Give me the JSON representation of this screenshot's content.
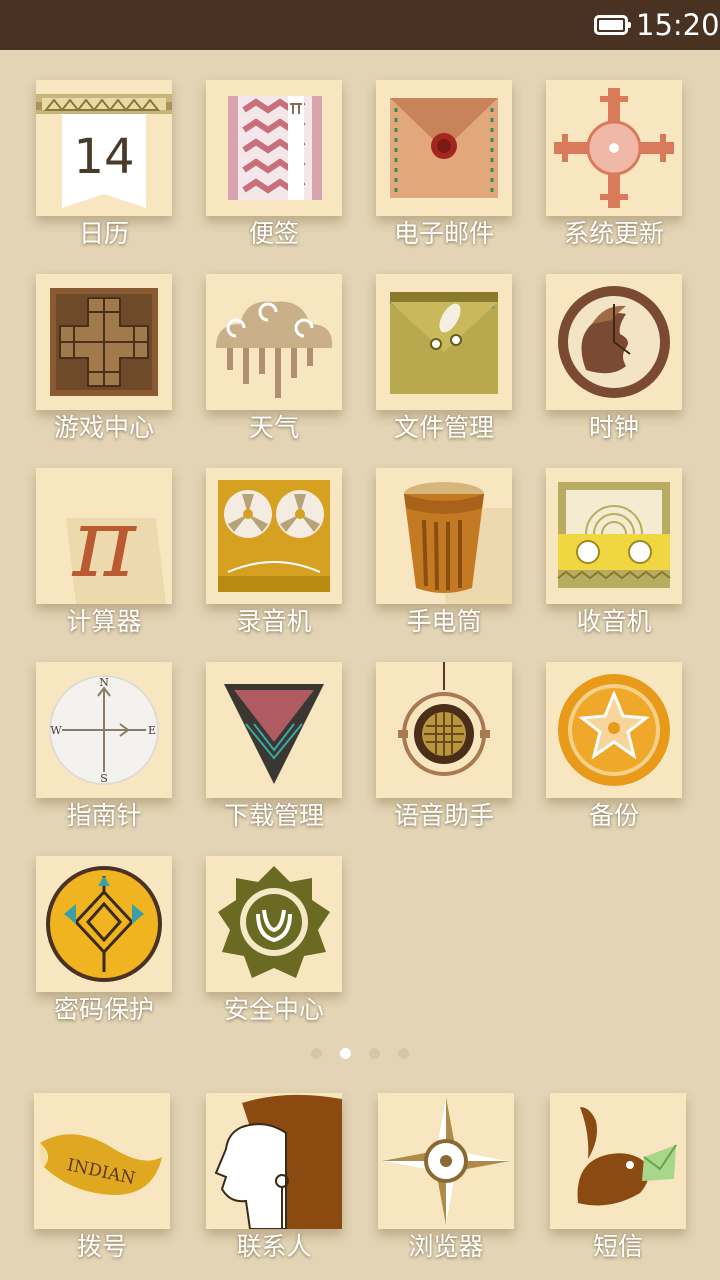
{
  "status_bar": {
    "time": "15:20",
    "battery_icon": "battery-full-icon"
  },
  "colors": {
    "status_bar": "#4a3222",
    "wallpaper": "#e2d4b4",
    "tile": "#f7e6bf"
  },
  "apps": [
    {
      "label": "日历",
      "icon": "calendar-icon",
      "day": "14"
    },
    {
      "label": "便签",
      "icon": "notes-icon"
    },
    {
      "label": "电子邮件",
      "icon": "email-envelope-icon"
    },
    {
      "label": "系统更新",
      "icon": "system-update-icon"
    },
    {
      "label": "游戏中心",
      "icon": "game-board-icon"
    },
    {
      "label": "天气",
      "icon": "weather-cloud-icon"
    },
    {
      "label": "文件管理",
      "icon": "file-folder-icon"
    },
    {
      "label": "时钟",
      "icon": "clock-icon"
    },
    {
      "label": "计算器",
      "icon": "pi-calculator-icon"
    },
    {
      "label": "录音机",
      "icon": "tape-recorder-icon"
    },
    {
      "label": "手电筒",
      "icon": "flashlight-drum-icon"
    },
    {
      "label": "收音机",
      "icon": "radio-icon"
    },
    {
      "label": "指南针",
      "icon": "compass-icon",
      "directions": [
        "N",
        "E",
        "S",
        "W"
      ]
    },
    {
      "label": "下载管理",
      "icon": "download-triangle-icon"
    },
    {
      "label": "语音助手",
      "icon": "microphone-icon"
    },
    {
      "label": "备份",
      "icon": "sheriff-star-icon"
    },
    {
      "label": "密码保护",
      "icon": "password-shield-icon"
    },
    {
      "label": "安全中心",
      "icon": "security-badge-icon"
    }
  ],
  "page_indicator": {
    "count": 4,
    "active": 2
  },
  "dock": [
    {
      "label": "拨号",
      "icon": "horn-phone-icon",
      "text": "INDIAN"
    },
    {
      "label": "联系人",
      "icon": "chief-portrait-icon"
    },
    {
      "label": "浏览器",
      "icon": "compass-rose-icon"
    },
    {
      "label": "短信",
      "icon": "bird-letter-icon"
    }
  ]
}
